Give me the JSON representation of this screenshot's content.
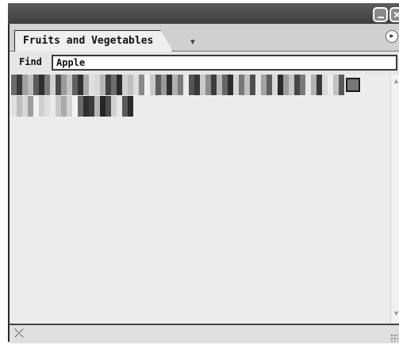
{
  "window": {
    "minimize_icon": "minimize-icon",
    "close_icon": "close-icon",
    "close_glyph": "✕"
  },
  "tab": {
    "label": "Fruits and Vegetables",
    "arrow_glyph": "▼"
  },
  "menu": {
    "icon": "menu-icon",
    "glyph": "▸"
  },
  "find": {
    "label": "Find",
    "value": "Apple"
  },
  "swatches": {
    "row1": [
      "#6a6a6a",
      "#3a3a3a",
      "#a0a0a0",
      "#bdbdbd",
      "#5a5a5a",
      "#2e2e2e",
      "#7a7a7a",
      "#d0d0d0",
      "#4a4a4a",
      "#9a9a9a",
      "#c4c4c4",
      "#606060",
      "#303030",
      "#a8a8a8",
      "#e0e0e0",
      "#d8d8d8",
      "#b4b4b4",
      "#404040",
      "#6e6e6e",
      "#2a2a2a",
      "#cfcfcf",
      "#bfbfbf",
      "#dcdcdc",
      "#8a8a8a",
      "#f0f0f0",
      "#c8c8c8",
      "#5c5c5c",
      "#999999",
      "#2f2f2f",
      "#b0b0b0",
      "#7c7c7c",
      "#eaeaea",
      "#545454",
      "#363636",
      "#cacaca",
      "#8e8e8e",
      "#3c3c3c",
      "#b8b8b8",
      "#666666",
      "#2c2c2c",
      "#d4d4d4",
      "#787878",
      "#c0c0c0",
      "#4e4e4e",
      "#e4e4e4",
      "#a4a4a4",
      "#5e5e5e",
      "#d8d8d8",
      "#2b2b2b",
      "#9c9c9c",
      "#c6c6c6",
      "#464646",
      "#7a7a7a",
      "#e8e8e8",
      "#b2b2b2",
      "#383838",
      "#dadada",
      "#ececec",
      "#c2c2c2",
      "#585858"
    ],
    "row2": [
      "#e0e0e0",
      "#bdbdbd",
      "#d6d6d6",
      "#9e9e9e",
      "#f0f0f0",
      "#cfcfcf",
      "#dedede",
      "#ebebeb",
      "#c8c8c8",
      "#aaaaaa",
      "#d2d2d2",
      "#f4f4f4",
      "#6a6a6a",
      "#2e2e2e",
      "#3c3c3c",
      "#b6b6b6",
      "#262626",
      "#4a4a4a",
      "#d0d0d0",
      "#e6e6e6",
      "#5a5a5a",
      "#2a2a2a"
    ],
    "selected_color": "#777777"
  },
  "status": {
    "icon": "crossed-swatch-icon",
    "glyph": "⤫"
  },
  "scroll": {
    "up_glyph": "▲",
    "down_glyph": "▼"
  }
}
